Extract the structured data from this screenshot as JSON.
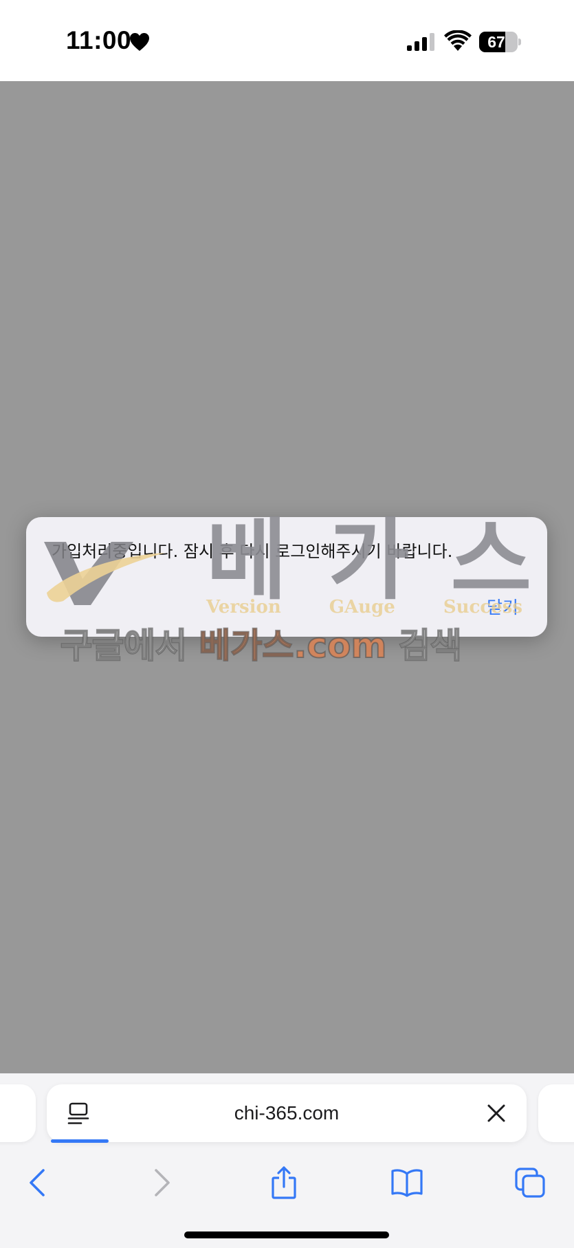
{
  "status_bar": {
    "time": "11:00",
    "battery": "67",
    "battery_level": 0.67,
    "icons": [
      "heart-icon",
      "cellular-signal-icon",
      "wifi-icon",
      "battery-icon"
    ]
  },
  "alert": {
    "message": "가입처리중입니다. 잠시 후 다시 로그인해주시기 바랍니다.",
    "close_label": "닫기"
  },
  "watermark": {
    "brand": "베가스",
    "taglines": [
      "Version",
      "GAuge",
      "Success"
    ],
    "search_prefix": "구글에서 ",
    "search_site": "베가스.com",
    "search_suffix": " 검색"
  },
  "browser": {
    "url": "chi-365.com",
    "toolbar": [
      "back-icon",
      "forward-icon",
      "share-icon",
      "bookmarks-icon",
      "tabs-icon"
    ]
  },
  "colors": {
    "accent": "#3478f6",
    "overlay": "#989898",
    "alert_bg": "#f0eff4"
  }
}
